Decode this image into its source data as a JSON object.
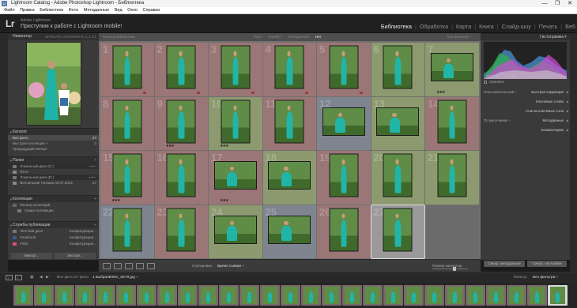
{
  "window": {
    "app_icon": "Lr",
    "title": "Lightroom Catalog - Adobe Photoshop Lightroom - Библиотека",
    "minimize": "—",
    "maximize": "❐",
    "close": "✕"
  },
  "menu": [
    "Файл",
    "Правка",
    "Библиотека",
    "Фото",
    "Метаданные",
    "Вид",
    "Окно",
    "Справка"
  ],
  "identity": {
    "logo": "Lr",
    "subtitle": "Adobe Lightroom",
    "main": "Приступим к работе с Lightroom mobile!"
  },
  "modules": {
    "items": [
      "Библиотека",
      "Обработка",
      "Карта",
      "Книга",
      "Слайд-шоу",
      "Печать",
      "Веб"
    ],
    "active": "Библиотека",
    "separator": "|"
  },
  "left_panel": {
    "navigator": {
      "title": "Навигатор",
      "zoom_options": "ВПИСАТЬ  ЗАПОЛНИТЬ  1:1  3:1"
    },
    "catalog": {
      "title": "Каталог",
      "items": [
        {
          "label": "Все фото",
          "count": "27",
          "selected": true
        },
        {
          "label": "Быстрая коллекция +",
          "count": "0",
          "selected": false
        },
        {
          "label": "Предыдущий импорт",
          "count": "",
          "selected": false
        }
      ]
    },
    "folders": {
      "title": "Папки",
      "add": "+",
      "items": [
        {
          "label": "Локальный диск (C:)",
          "count": "—/—",
          "bar": true
        },
        {
          "label": "Фото",
          "count": "",
          "bar": false
        },
        {
          "label": "Локальный диск (D:)",
          "count": "—/—",
          "bar": true
        },
        {
          "label": "Венчальная Наташи 06.07.2014",
          "count": "27",
          "bar": false
        }
      ]
    },
    "collections": {
      "title": "Коллекции",
      "add": "+",
      "items": [
        {
          "label": "Фильтр коллекций"
        },
        {
          "label": "Смарт-коллекции"
        }
      ]
    },
    "publish": {
      "title": "Службы публикации",
      "add": "+",
      "items": [
        {
          "label": "Жесткий диск",
          "action": "Конфигурация..."
        },
        {
          "label": "Facebook",
          "action": "Конфигурация..."
        },
        {
          "label": "Flickr",
          "action": "Конфигурация..."
        }
      ]
    },
    "import_btn": "Импорт...",
    "export_btn": "Экспорт..."
  },
  "filter_bar": {
    "label": "Фильтр библиотеки:",
    "options": [
      "Текст",
      "Атрибут",
      "Метаданные",
      "Нет"
    ],
    "active": "Нет",
    "preset": "Без фильтра ÷"
  },
  "grid": {
    "cells": [
      {
        "num": "1",
        "tint": "#9b7676",
        "shape": "p",
        "stars": "",
        "flag": true
      },
      {
        "num": "2",
        "tint": "#9b7676",
        "shape": "p",
        "stars": "",
        "flag": true
      },
      {
        "num": "3",
        "tint": "#9b7676",
        "shape": "p",
        "stars": "",
        "flag": true
      },
      {
        "num": "4",
        "tint": "#9b7676",
        "shape": "p",
        "stars": "",
        "flag": true
      },
      {
        "num": "5",
        "tint": "#9b7676",
        "shape": "p",
        "stars": "",
        "flag": true
      },
      {
        "num": "6",
        "tint": "#8d9a6f",
        "shape": "p",
        "stars": "",
        "flag": false
      },
      {
        "num": "7",
        "tint": "#8d9a6f",
        "shape": "l",
        "stars": "★★★",
        "flag": false
      },
      {
        "num": "8",
        "tint": "#9b7676",
        "shape": "p",
        "stars": "",
        "flag": false
      },
      {
        "num": "9",
        "tint": "#9b7676",
        "shape": "p",
        "stars": "★★★",
        "flag": false
      },
      {
        "num": "10",
        "tint": "#8d9a6f",
        "shape": "p",
        "stars": "★★★",
        "flag": false
      },
      {
        "num": "11",
        "tint": "#9b7676",
        "shape": "p",
        "stars": "",
        "flag": false
      },
      {
        "num": "12",
        "tint": "#7f8590",
        "shape": "l",
        "stars": "",
        "flag": false
      },
      {
        "num": "13",
        "tint": "#8d9a6f",
        "shape": "l",
        "stars": "",
        "flag": false
      },
      {
        "num": "14",
        "tint": "#9b7676",
        "shape": "p",
        "stars": "",
        "flag": false
      },
      {
        "num": "15",
        "tint": "#9b7676",
        "shape": "p",
        "stars": "★★★",
        "flag": false
      },
      {
        "num": "16",
        "tint": "#9b7676",
        "shape": "p",
        "stars": "",
        "flag": false
      },
      {
        "num": "17",
        "tint": "#9b7676",
        "shape": "l",
        "stars": "★★★",
        "flag": false
      },
      {
        "num": "18",
        "tint": "#8d9a6f",
        "shape": "l",
        "stars": "",
        "flag": false
      },
      {
        "num": "19",
        "tint": "#9b7676",
        "shape": "p",
        "stars": "",
        "flag": false
      },
      {
        "num": "20",
        "tint": "#8d9a6f",
        "shape": "p",
        "stars": "",
        "flag": false
      },
      {
        "num": "21",
        "tint": "#8d9a6f",
        "shape": "p",
        "stars": "",
        "flag": false
      },
      {
        "num": "22",
        "tint": "#7f8590",
        "shape": "p",
        "stars": "",
        "flag": false
      },
      {
        "num": "23",
        "tint": "#9b7676",
        "shape": "p",
        "stars": "",
        "flag": false
      },
      {
        "num": "24",
        "tint": "#8d9a6f",
        "shape": "l",
        "stars": "",
        "flag": false
      },
      {
        "num": "25",
        "tint": "#7f8590",
        "shape": "l",
        "stars": "",
        "flag": false
      },
      {
        "num": "26",
        "tint": "#9b7676",
        "shape": "p",
        "stars": "",
        "flag": false
      },
      {
        "num": "27",
        "tint": "#9a9a9a",
        "shape": "p",
        "stars": "",
        "flag": false,
        "selected": true
      },
      {
        "num": "",
        "tint": "#6b6b6b",
        "shape": "",
        "stars": "",
        "flag": false
      }
    ]
  },
  "toolbar": {
    "sort_label": "Сортировка:",
    "sort_value": "Время съёмки ÷",
    "thumb_size": "Размер миниатюр",
    "view_icons": [
      "grid-view-icon",
      "loupe-view-icon",
      "compare-view-icon",
      "survey-view-icon",
      "people-view-icon"
    ]
  },
  "right_panel": {
    "histogram": {
      "title": "Гистограмма",
      "readouts": [
        "ISO 100",
        "50 мм",
        "f/ 11,0",
        "1/250 с"
      ],
      "original": "Оригинал"
    },
    "preset_select": "Пользовательский ÷",
    "quick_develop": "Быстрая коррекция",
    "keywords": "Ключевые слова",
    "keyword_list": "Список ключевых слов",
    "metadata_select": "По умолчанию ÷",
    "metadata": "Метаданные",
    "comments": "Комментарии",
    "sync_btn": "Синхр. метаданные",
    "sync_settings": "Синхр. настройки"
  },
  "filmbar": {
    "page1": "1",
    "page2": "2",
    "source": "Все фото",
    "count": "27 фото",
    "selected": "1 выбрано",
    "file": "/ IMG_0579.jpg ÷",
    "filter_label": "Фильтр:",
    "filter_value": "Без фильтра ÷"
  },
  "filmstrip": {
    "thumbs": 27,
    "selected_index": 26
  }
}
